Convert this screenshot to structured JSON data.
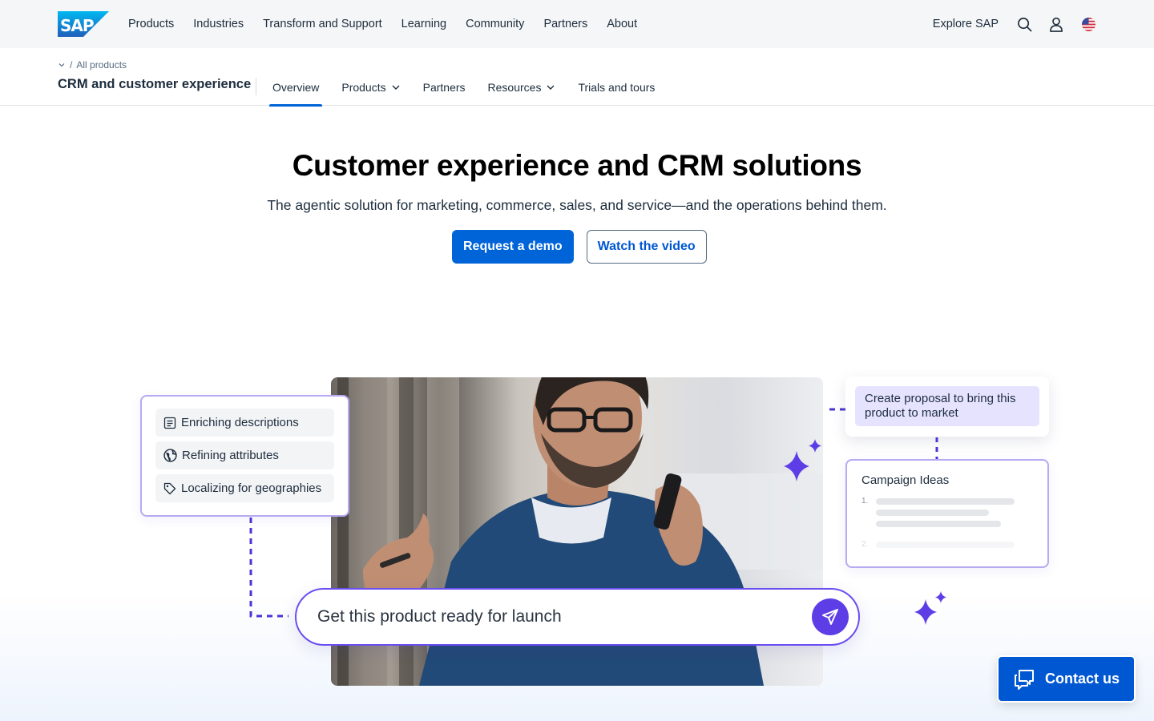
{
  "topnav": {
    "logo_text": "SAP",
    "items": [
      "Products",
      "Industries",
      "Transform and Support",
      "Learning",
      "Community",
      "Partners",
      "About"
    ],
    "explore_label": "Explore SAP",
    "icons": [
      "search-icon",
      "user-icon",
      "us-flag-icon"
    ]
  },
  "subnav": {
    "breadcrumb": "All products",
    "title": "CRM and customer experience",
    "tabs": [
      {
        "label": "Overview",
        "active": true
      },
      {
        "label": "Products",
        "dropdown": true
      },
      {
        "label": "Partners"
      },
      {
        "label": "Resources",
        "dropdown": true
      },
      {
        "label": "Trials and tours"
      }
    ]
  },
  "hero": {
    "title": "Customer experience and CRM solutions",
    "subtitle": "The agentic solution for marketing, commerce, sales, and service—and the operations behind them.",
    "primary_cta": "Request a demo",
    "secondary_cta": "Watch the video"
  },
  "illustration": {
    "features": [
      {
        "icon": "text-document-icon",
        "label": "Enriching descriptions"
      },
      {
        "icon": "globe-icon",
        "label": "Refining attributes"
      },
      {
        "icon": "tag-icon",
        "label": "Localizing for geographies"
      }
    ],
    "proposal_text": "Create proposal to bring this product to market",
    "campaign": {
      "title": "Campaign Ideas",
      "numbers": [
        "1.",
        "2."
      ]
    },
    "prompt_text": "Get this product ready for launch",
    "accent_color": "#5d3ee6"
  },
  "contact": {
    "label": "Contact us"
  },
  "colors": {
    "primary": "#0064d9",
    "contact": "#0057d2",
    "accent_purple": "#5d3ee6"
  }
}
